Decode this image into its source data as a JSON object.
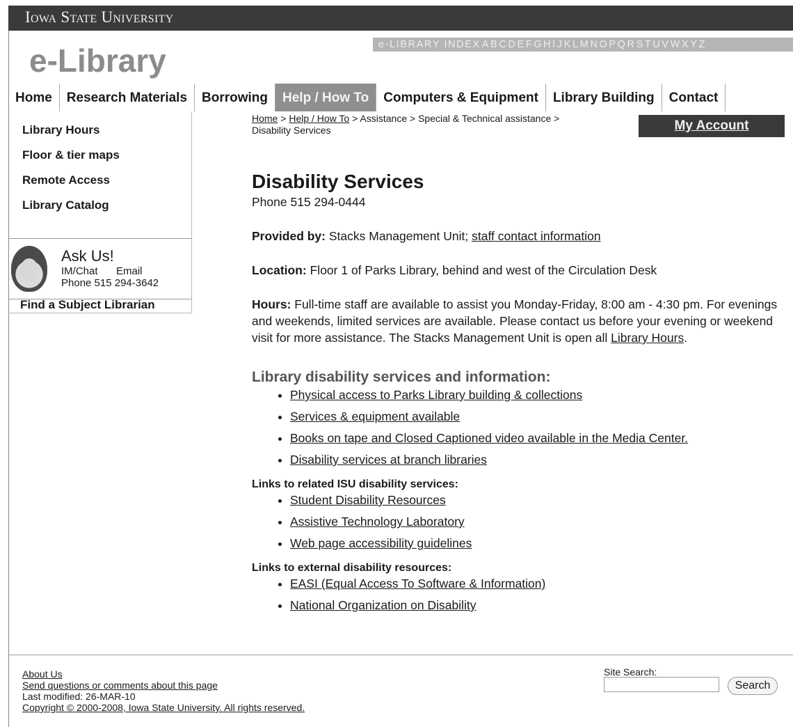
{
  "header": {
    "university": "Iowa State University",
    "site_title": "e-Library",
    "az_label": "e-LIBRARY INDEX",
    "az_letters": [
      "A",
      "B",
      "C",
      "D",
      "E",
      "F",
      "G",
      "H",
      "I",
      "J",
      "K",
      "L",
      "M",
      "N",
      "O",
      "P",
      "Q",
      "R",
      "S",
      "T",
      "U",
      "V",
      "W",
      "X",
      "Y",
      "Z"
    ]
  },
  "nav": {
    "items": [
      {
        "label": "Home"
      },
      {
        "label": "Research Materials"
      },
      {
        "label": "Borrowing"
      },
      {
        "label": "Help / How To"
      },
      {
        "label": "Computers & Equipment"
      },
      {
        "label": "Library Building"
      },
      {
        "label": "Contact"
      }
    ],
    "active": "Help / How To"
  },
  "sidebar": {
    "items": [
      {
        "label": "Library Hours"
      },
      {
        "label": "Floor & tier maps"
      },
      {
        "label": "Remote Access"
      },
      {
        "label": "Library Catalog"
      }
    ],
    "ask": {
      "title": "Ask Us!",
      "im": "IM/Chat",
      "email": "Email",
      "phone": "Phone 515 294-3642"
    },
    "find_subject": "Find a Subject Librarian"
  },
  "breadcrumb": {
    "home": "Home",
    "help": "Help / How To",
    "rest": " > Assistance > Special & Technical assistance > ",
    "current": "Disability Services",
    "sep": " > "
  },
  "account": {
    "label": "My Account"
  },
  "main": {
    "title": "Disability Services",
    "phone": "Phone 515 294-0444",
    "provided_label": "Provided by:",
    "provided_text": " Stacks Management Unit; ",
    "provided_link": "staff contact information",
    "location_label": "Location:",
    "location_text": " Floor 1 of Parks Library, behind and west of the Circulation Desk",
    "hours_label": "Hours:",
    "hours_text": " Full-time staff are available to assist you Monday-Friday, 8:00 am - 4:30 pm. For evenings and weekends, limited services are available. Please contact us before your evening or weekend visit for more assistance. The Stacks Management Unit is open all ",
    "hours_link": "Library Hours",
    "hours_end": ".",
    "section1_title": "Library disability services and information:",
    "section1_links": [
      "Physical access to Parks Library building & collections",
      "Services & equipment available",
      "Books on tape and Closed Captioned video available in the Media Center.",
      "Disability services at branch libraries"
    ],
    "section2_title": "Links to related ISU disability services:",
    "section2_links": [
      "Student Disability Resources",
      "Assistive Technology Laboratory",
      "Web page accessibility guidelines"
    ],
    "section3_title": "Links to external disability resources:",
    "section3_links": [
      "EASI (Equal Access To Software & Information)",
      "National Organization on Disability"
    ]
  },
  "footer": {
    "about": "About Us",
    "send": "Send questions or comments about this page",
    "modified": "Last modified: 26-MAR-10",
    "copyright": "Copyright © 2000-2008, Iowa State University. All rights reserved.",
    "search_label": "Site Search:",
    "search_value": "",
    "search_button": "Search"
  }
}
